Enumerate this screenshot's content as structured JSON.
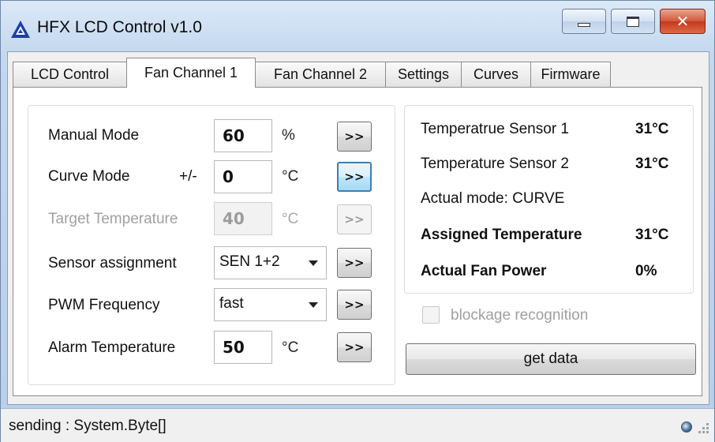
{
  "window": {
    "title": "HFX LCD Control v1.0",
    "close_glyph": "✕"
  },
  "tabs": [
    {
      "label": "LCD Control",
      "active": false
    },
    {
      "label": "Fan Channel 1",
      "active": true
    },
    {
      "label": "Fan Channel 2",
      "active": false
    },
    {
      "label": "Settings",
      "active": false
    },
    {
      "label": "Curves",
      "active": false
    },
    {
      "label": "Firmware",
      "active": false
    }
  ],
  "fan_channel": {
    "manual_mode": {
      "label": "Manual Mode",
      "value": "60",
      "unit": "%",
      "button": ">>"
    },
    "curve_mode": {
      "label": "Curve Mode",
      "prefix": "+/-",
      "value": "0",
      "unit": "°C",
      "button": ">>"
    },
    "target_temperature": {
      "label": "Target Temperature",
      "value": "40",
      "unit": "°C",
      "button": ">>",
      "enabled": false
    },
    "sensor_assignment": {
      "label": "Sensor assignment",
      "value": "SEN 1+2",
      "button": ">>"
    },
    "pwm_frequency": {
      "label": "PWM Frequency",
      "value": "fast",
      "button": ">>"
    },
    "alarm_temperature": {
      "label": "Alarm Temperature",
      "value": "50",
      "unit": "°C",
      "button": ">>"
    }
  },
  "readout": {
    "sensor1": {
      "label": "Temperatrue Sensor 1",
      "value": "31°C"
    },
    "sensor2": {
      "label": "Temperature Sensor 2",
      "value": "31°C"
    },
    "actual_mode": "Actual mode: CURVE",
    "assigned_temperature": {
      "label": "Assigned Temperature",
      "value": "31°C"
    },
    "actual_fan_power": {
      "label": "Actual Fan Power",
      "value": "0%"
    }
  },
  "blockage_recognition": {
    "label": "blockage recognition",
    "checked": false,
    "enabled": false
  },
  "get_data_label": "get data",
  "status": {
    "text": "sending : System.Byte[]"
  },
  "colors": {
    "accent_blue": "#3c7fb1",
    "close_red": "#c4381c",
    "disabled_text": "#a0a0a0"
  }
}
